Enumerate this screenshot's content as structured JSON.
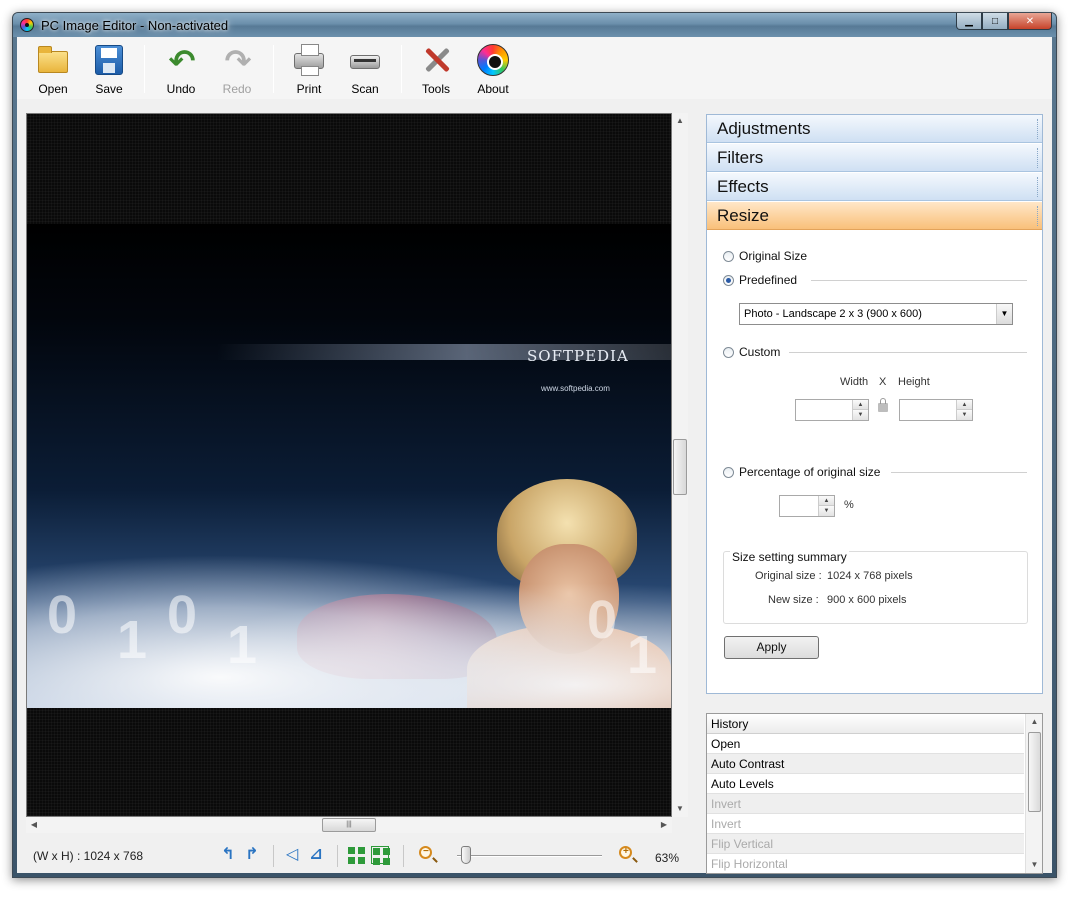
{
  "window": {
    "title": "PC Image Editor - Non-activated",
    "controls": {
      "minimize": "▁",
      "maximize": "□",
      "close": "✕"
    }
  },
  "toolbar": {
    "open": "Open",
    "save": "Save",
    "undo": "Undo",
    "redo": "Redo",
    "print": "Print",
    "scan": "Scan",
    "tools": "Tools",
    "about": "About"
  },
  "canvas": {
    "watermark_brand": "SOFTPEDIA",
    "watermark_url": "www.softpedia.com"
  },
  "status": {
    "dimensions": "(W x H) : 1024 x 768",
    "zoom": "63%",
    "zoom_level": 0.18
  },
  "panel": {
    "sections": [
      "Adjustments",
      "Filters",
      "Effects",
      "Resize"
    ],
    "active_section": "Resize",
    "resize": {
      "original_size": "Original Size",
      "predefined": "Predefined",
      "predefined_value": "Photo - Landscape 2 x 3 (900 x 600)",
      "custom": "Custom",
      "width_label": "Width",
      "x_label": "X",
      "height_label": "Height",
      "percentage": "Percentage of original size",
      "percent_sign": "%",
      "summary_title": "Size setting summary",
      "original_size_label": "Original size :",
      "original_size_value": "1024 x 768 pixels",
      "new_size_label": "New size :",
      "new_size_value": "900 x 600 pixels",
      "apply": "Apply"
    }
  },
  "history": {
    "header": "History",
    "items": [
      {
        "label": "Open",
        "active": true
      },
      {
        "label": "Auto Contrast",
        "active": true
      },
      {
        "label": "Auto Levels",
        "active": true
      },
      {
        "label": "Invert",
        "active": false
      },
      {
        "label": "Invert",
        "active": false
      },
      {
        "label": "Flip Vertical",
        "active": false
      },
      {
        "label": "Flip Horizontal",
        "active": false
      }
    ]
  },
  "colors": {
    "accordion_active": "#f9c07a",
    "accordion": "#cfe0f3",
    "icon_green": "#2e9a3a",
    "icon_blue": "#2a74c2"
  }
}
